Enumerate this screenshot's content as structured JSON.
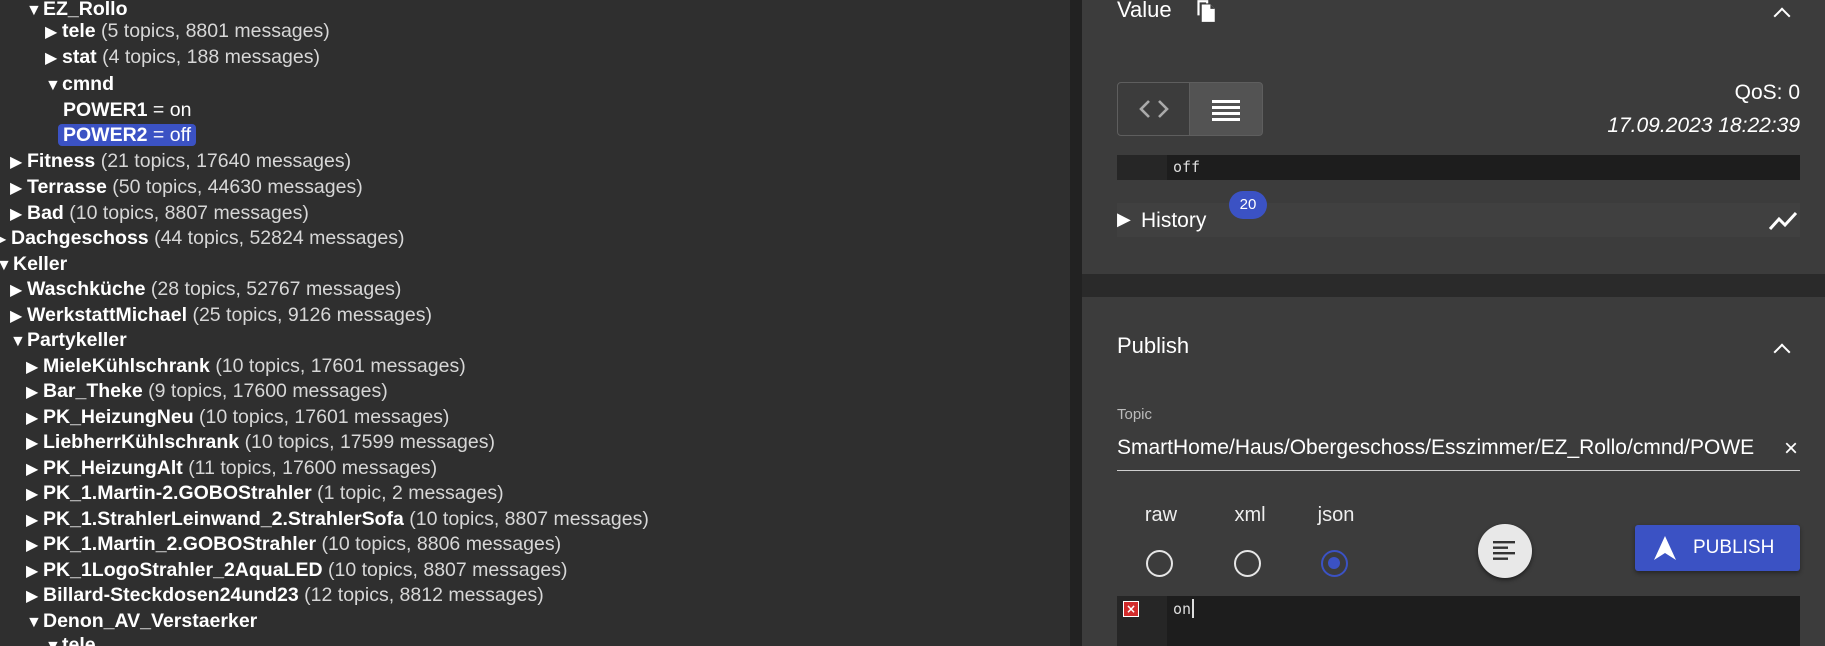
{
  "tree": {
    "ez_rollo": {
      "name": "EZ_Rollo"
    },
    "tele": {
      "name": "tele",
      "meta": "(5 topics, 8801 messages)"
    },
    "stat": {
      "name": "stat",
      "meta": "(4 topics, 188 messages)"
    },
    "cmnd": {
      "name": "cmnd"
    },
    "power1": {
      "key": "POWER1",
      "val": " = on"
    },
    "power2": {
      "key": "POWER2",
      "val": " = off"
    },
    "fitness": {
      "name": "Fitness",
      "meta": "(21 topics, 17640 messages)"
    },
    "terrasse": {
      "name": "Terrasse",
      "meta": "(50 topics, 44630 messages)"
    },
    "bad": {
      "name": "Bad",
      "meta": "(10 topics, 8807 messages)"
    },
    "dachgeschoss": {
      "name": "Dachgeschoss",
      "meta": "(44 topics, 52824 messages)"
    },
    "keller": {
      "name": "Keller"
    },
    "waschkueche": {
      "name": "Waschküche",
      "meta": "(28 topics, 52767 messages)"
    },
    "werkstatt": {
      "name": "WerkstattMichael",
      "meta": "(25 topics, 9126 messages)"
    },
    "partykeller": {
      "name": "Partykeller"
    },
    "miele": {
      "name": "MieleKühlschrank",
      "meta": "(10 topics, 17601 messages)"
    },
    "bar": {
      "name": "Bar_Theke",
      "meta": "(9 topics, 17600 messages)"
    },
    "heizung_neu": {
      "name": "PK_HeizungNeu",
      "meta": "(10 topics, 17601 messages)"
    },
    "liebherr": {
      "name": "LiebherrKühlschrank",
      "meta": "(10 topics, 17599 messages)"
    },
    "heizung_alt": {
      "name": "PK_HeizungAlt",
      "meta": "(11 topics, 17600 messages)"
    },
    "martin_gobo": {
      "name": "PK_1.Martin-2.GOBOStrahler",
      "meta": "(1 topic, 2 messages)"
    },
    "strahler_leinwand": {
      "name": "PK_1.StrahlerLeinwand_2.StrahlerSofa",
      "meta": "(10 topics, 8807 messages)"
    },
    "martin_gobo2": {
      "name": "PK_1.Martin_2.GOBOStrahler",
      "meta": "(10 topics, 8806 messages)"
    },
    "logo_strahler": {
      "name": "PK_1LogoStrahler_2AquaLED",
      "meta": "(10 topics, 8807 messages)"
    },
    "billard": {
      "name": "Billard-Steckdosen24und23",
      "meta": "(12 topics, 8812 messages)"
    },
    "denon": {
      "name": "Denon_AV_Verstaerker"
    },
    "denon_tele": {
      "name": "tele"
    }
  },
  "value": {
    "title": "Value",
    "qos": "QoS: 0",
    "timestamp": "17.09.2023 18:22:39",
    "payload": "off",
    "history_label": "History",
    "history_count": "20"
  },
  "publish": {
    "title": "Publish",
    "topic_label": "Topic",
    "topic_value": "SmartHome/Haus/Obergeschoss/Esszimmer/EZ_Rollo/cmnd/POWE",
    "formats": [
      "raw",
      "xml",
      "json"
    ],
    "selected_format": "json",
    "button_label": "PUBLISH",
    "payload": "on"
  },
  "colors": {
    "accent": "#3b52c4",
    "background": "#2f2f2f",
    "panel": "#3c3c3c"
  }
}
